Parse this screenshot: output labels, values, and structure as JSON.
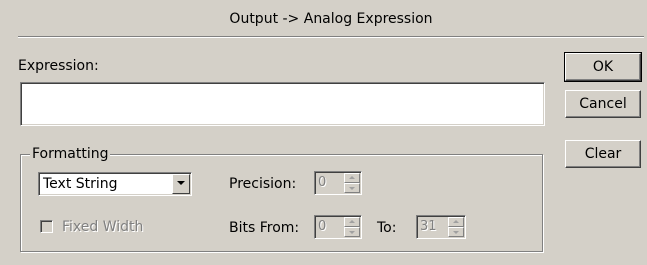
{
  "window": {
    "title": "Output -> Analog Expression"
  },
  "expression": {
    "label": "Expression:",
    "value": ""
  },
  "buttons": {
    "ok": "OK",
    "cancel": "Cancel",
    "clear": "Clear"
  },
  "formatting": {
    "legend": "Formatting",
    "format_select": {
      "value": "Text String"
    },
    "fixed_width": {
      "label": "Fixed Width",
      "checked": false,
      "enabled": false
    },
    "precision": {
      "label": "Precision:",
      "value": "0"
    },
    "bits_from": {
      "label": "Bits From:",
      "value": "0"
    },
    "bits_to": {
      "label": "To:",
      "value": "31"
    }
  }
}
